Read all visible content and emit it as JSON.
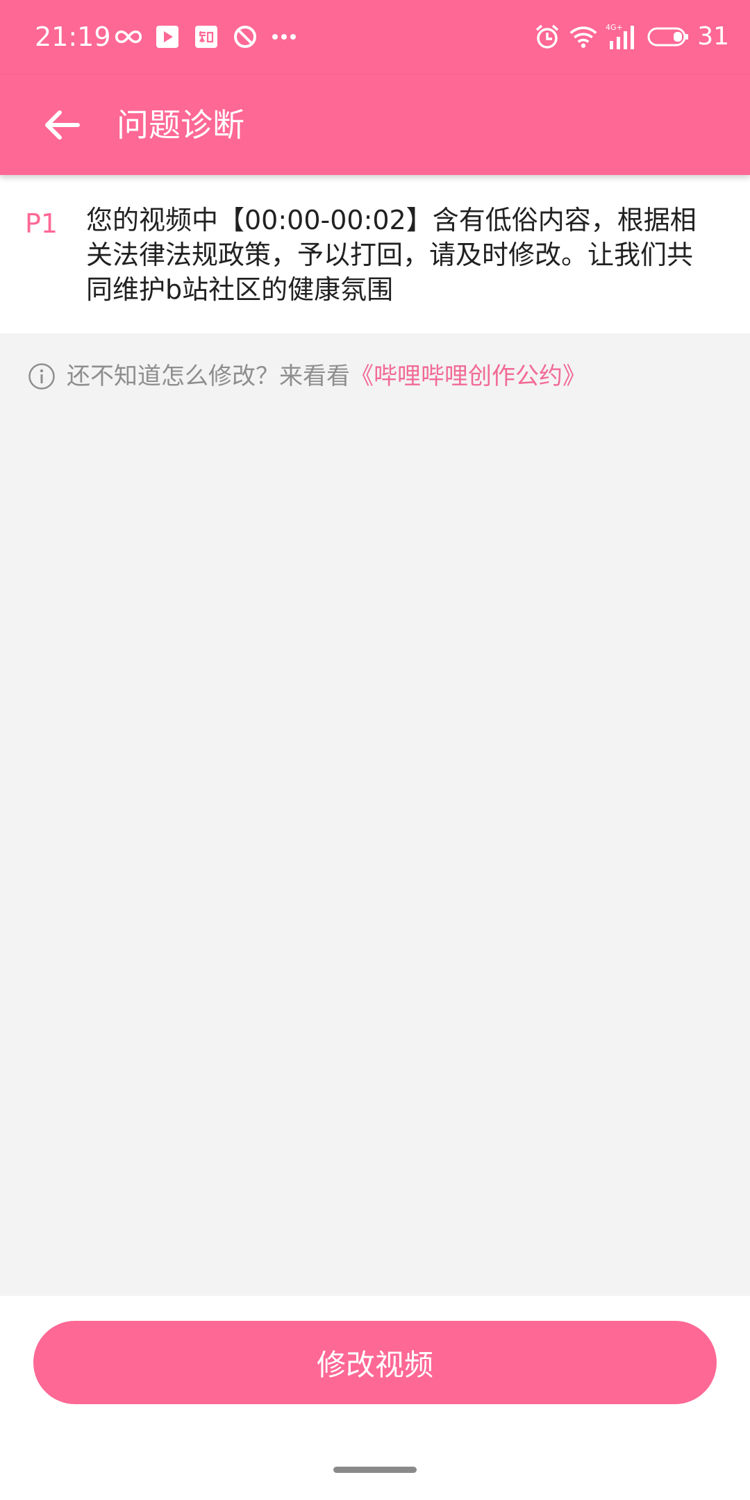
{
  "status_bar": {
    "time": "21:19",
    "battery_level": "31",
    "network_label": "4G+",
    "left_icons": [
      "infinity-icon",
      "video-app-icon",
      "zhihu-app-icon",
      "blocked-icon",
      "more-dots-icon"
    ],
    "right_icons": [
      "alarm-icon",
      "wifi-icon",
      "signal-icon",
      "battery-icon"
    ]
  },
  "app_bar": {
    "title": "问题诊断",
    "back_icon": "arrow-left-icon"
  },
  "issue": {
    "tag": "P1",
    "text": "您的视频中【00:00-00:02】含有低俗内容，根据相关法律法规政策，予以打回，请及时修改。让我们共同维护b站社区的健康氛围"
  },
  "hint": {
    "icon": "info-icon",
    "text": "还不知道怎么修改？来看看",
    "link": "《哔哩哔哩创作公约》"
  },
  "action": {
    "button_label": "修改视频"
  },
  "colors": {
    "accent": "#fe6895",
    "link": "#f26a96",
    "background": "#f3f3f3",
    "hint_text": "#8e8e8e"
  }
}
